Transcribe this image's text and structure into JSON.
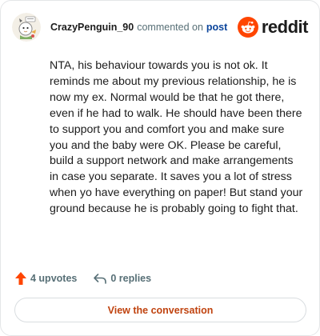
{
  "header": {
    "username": "CrazyPenguin_90",
    "commented_text": "commented on",
    "post_link": "post",
    "brand": "reddit"
  },
  "comment": {
    "text": "NTA, his behaviour towards you is not ok. It reminds me about my previous relationship, he is now my ex. Normal would be that he got there, even if he had to walk. He should have been there to support you and comfort you and make sure you and the baby were OK. Please be careful, build a support network and make arrangements in case you separate. It saves you a lot of stress when yo have everything on paper! But stand your ground because he is probably going to fight that."
  },
  "footer": {
    "upvotes_label": "4 upvotes",
    "replies_label": "0 replies",
    "view_button": "View the conversation"
  },
  "colors": {
    "brand_orange": "#ff4500",
    "upvote_orange": "#ff4500",
    "link_blue": "#0a449b",
    "button_text": "#c0430f",
    "meta_gray": "#576f76"
  },
  "icons": {
    "avatar": "penguin-avatar",
    "brand": "reddit-snoo-logo",
    "upvote": "upvote-arrow-icon",
    "reply": "reply-arrow-icon"
  }
}
